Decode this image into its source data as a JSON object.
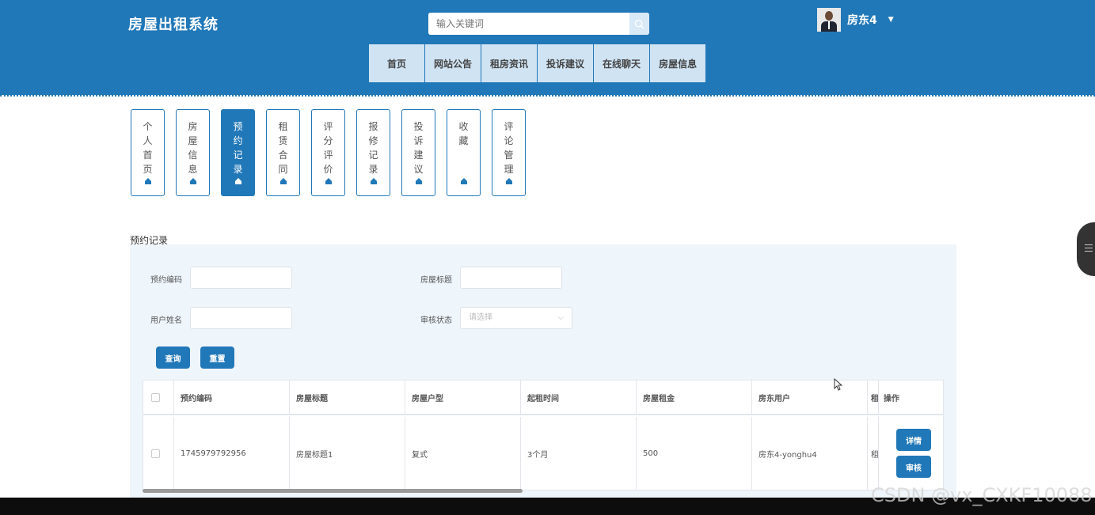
{
  "header": {
    "site_title": "房屋出租系统",
    "search_placeholder": "输入关键词",
    "user_name": "房东4",
    "nav": [
      "首页",
      "网站公告",
      "租房资讯",
      "投诉建议",
      "在线聊天",
      "房屋信息"
    ]
  },
  "tabs": [
    {
      "label": "个人首页",
      "active": false
    },
    {
      "label": "房屋信息",
      "active": false
    },
    {
      "label": "预约记录",
      "active": true
    },
    {
      "label": "租赁合同",
      "active": false
    },
    {
      "label": "评分评价",
      "active": false
    },
    {
      "label": "报修记录",
      "active": false
    },
    {
      "label": "投诉建议",
      "active": false
    },
    {
      "label": "收藏",
      "active": false
    },
    {
      "label": "评论管理",
      "active": false
    }
  ],
  "section_title": "预约记录",
  "filters": {
    "code_label": "预约编码",
    "title_label": "房屋标题",
    "user_label": "用户姓名",
    "status_label": "审核状态",
    "status_placeholder": "请选择",
    "query_button": "查询",
    "reset_button": "重置"
  },
  "table": {
    "columns": [
      "预约编码",
      "房屋标题",
      "房屋户型",
      "起租时间",
      "房屋租金",
      "房东用户",
      "租",
      "操作"
    ],
    "rows": [
      [
        "1745979792956",
        "房屋标题1",
        "复式",
        "3个月",
        "500",
        "房东4-yonghu4",
        "租"
      ]
    ],
    "detail_button": "详情",
    "review_button": "审核"
  },
  "watermark": "CSDN @vx_CXKF10088",
  "colors": {
    "primary": "#2178b8",
    "nav_bg": "#cfe3f3",
    "panel_bg": "#eef5fb"
  }
}
